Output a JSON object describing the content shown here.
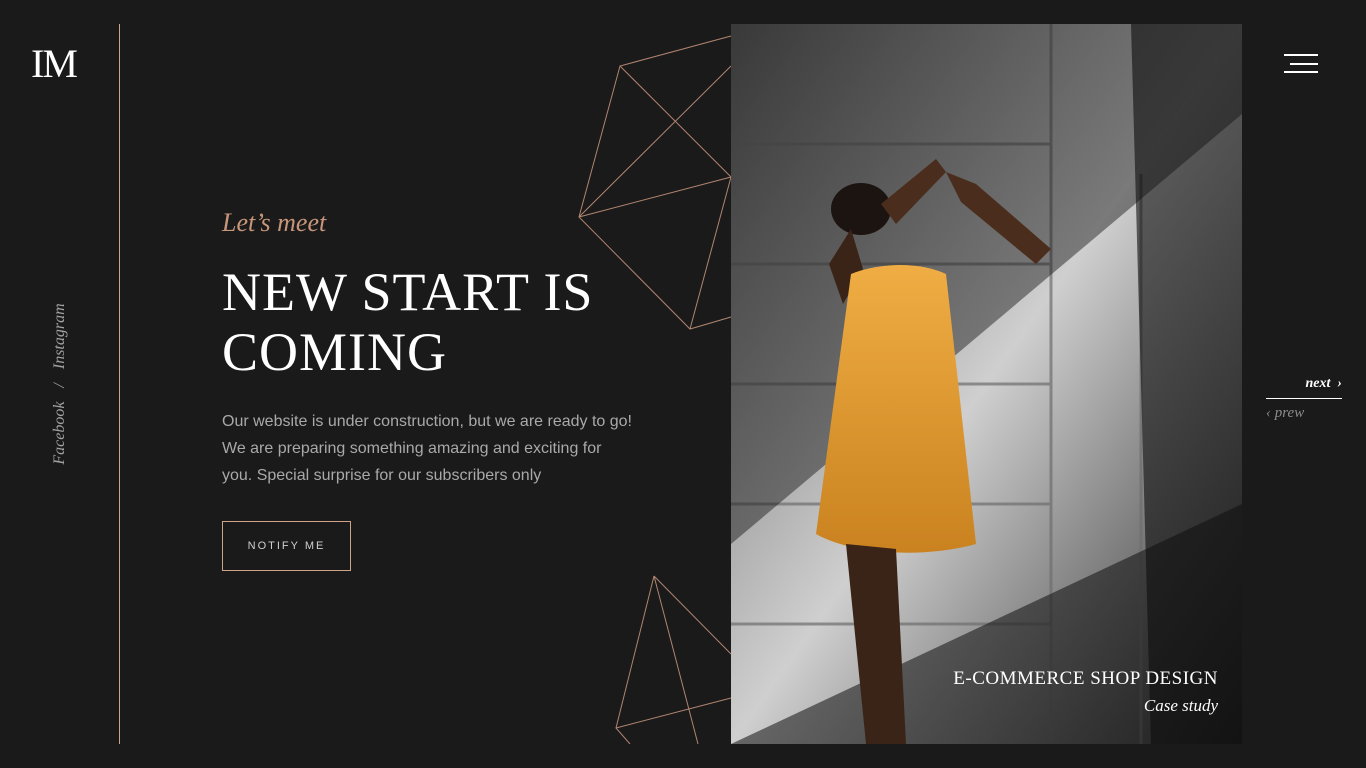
{
  "brand": {
    "logo": "IM"
  },
  "social": {
    "facebook": "Facebook",
    "separator": "/",
    "instagram": "Instagram"
  },
  "hero": {
    "kicker": "Let’s meet",
    "title_line1": "NEW START IS",
    "title_line2": "COMING",
    "description": "Our website is under construction, but we are ready to go! We are preparing something amazing and exciting for you. Special surprise for our subscribers only",
    "notify_label": "NOTIFY ME"
  },
  "project": {
    "title": "E-COMMERCE SHOP DESIGN",
    "subtitle": "Case study"
  },
  "pager": {
    "next_label": "next",
    "next_icon": "›",
    "prev_icon": "‹",
    "prev_label": "prew"
  },
  "icons": {
    "menu": "hamburger-icon",
    "next": "chevron-right-icon",
    "prev": "chevron-left-icon"
  },
  "colors": {
    "background": "#1b1a1b",
    "accent": "#d0a48a",
    "kicker": "#c7967a",
    "text": "#ffffff",
    "muted": "#a9a9a9",
    "dress": "#e8a33a"
  }
}
